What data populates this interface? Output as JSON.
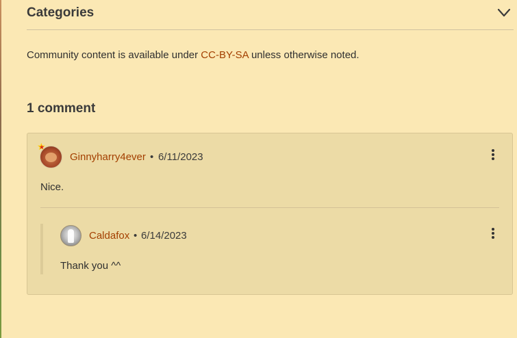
{
  "categories": {
    "title": "Categories"
  },
  "license": {
    "prefix": "Community content is available under ",
    "link_text": "CC-BY-SA",
    "suffix": " unless otherwise noted."
  },
  "comments_section": {
    "count_label": "1 comment",
    "comments": [
      {
        "author": "Ginnyharry4ever",
        "separator": "•",
        "date": "6/11/2023",
        "text": "Nice.",
        "replies": [
          {
            "author": "Caldafox",
            "separator": "•",
            "date": "6/14/2023",
            "text": "Thank you ^^"
          }
        ]
      }
    ]
  },
  "colors": {
    "background": "#fbe8b4",
    "card": "#ecdba6",
    "link": "#a33f00",
    "text": "#3a3a3a"
  },
  "icons": {
    "collapse": "chevron-down-icon",
    "menu": "more-vertical-icon",
    "badge": "star-badge-icon"
  }
}
